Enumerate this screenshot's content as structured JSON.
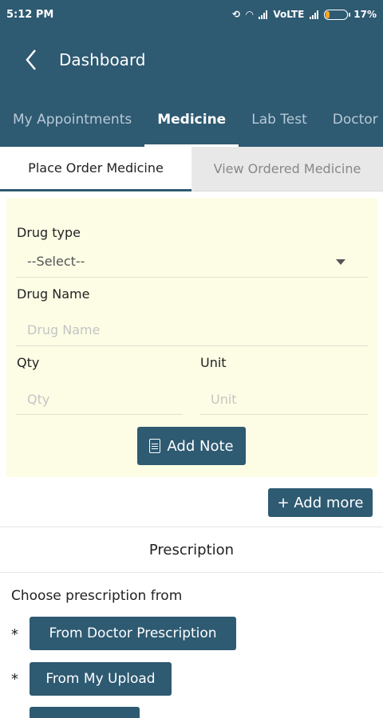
{
  "status_bar": {
    "time": "5:12 PM",
    "network": "VoLTE",
    "battery": "17%",
    "battery_level": 0.17
  },
  "app_bar": {
    "title": "Dashboard"
  },
  "tabs": [
    {
      "label": "My Appointments",
      "active": false
    },
    {
      "label": "Medicine",
      "active": true
    },
    {
      "label": "Lab Test",
      "active": false
    },
    {
      "label": "Doctor P",
      "active": false
    }
  ],
  "sub_tabs": [
    {
      "label": "Place Order Medicine",
      "active": true
    },
    {
      "label": "View Ordered Medicine",
      "active": false
    }
  ],
  "form": {
    "drug_type_label": "Drug type",
    "drug_type_value": "--Select--",
    "drug_name_label": "Drug Name",
    "drug_name_placeholder": "Drug Name",
    "qty_label": "Qty",
    "qty_placeholder": "Qty",
    "unit_label": "Unit",
    "unit_placeholder": "Unit",
    "add_note_label": "Add Note"
  },
  "add_more_label": "+ Add more",
  "prescription": {
    "title": "Prescription",
    "choose_label": "Choose prescription from",
    "bullet": "*",
    "options": [
      "From Doctor Prescription",
      "From My Upload"
    ]
  },
  "colors": {
    "primary": "#2e5a72",
    "form_background": "#fdfde6",
    "inactive_tab_background": "#e8e8e8"
  }
}
